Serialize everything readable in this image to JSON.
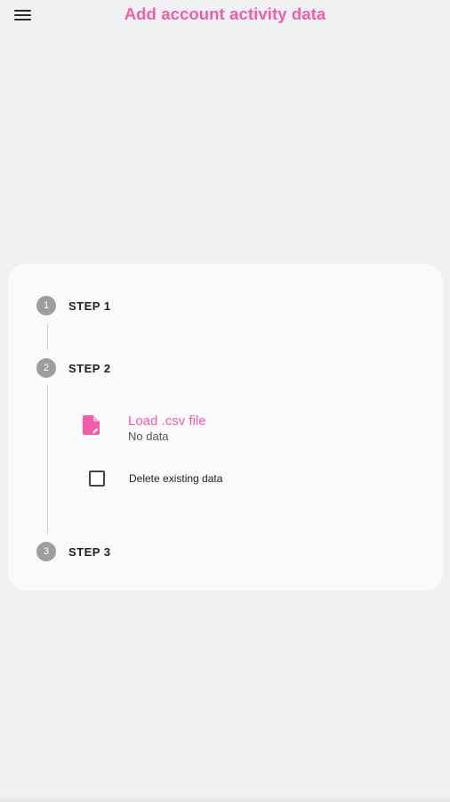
{
  "app_bar": {
    "title": "Add account activity data",
    "menu_icon": "menu-icon"
  },
  "colors": {
    "accent": "#f45cab",
    "background": "#f0f1f3",
    "card": "#fafafa",
    "step_circle": "#9e9e9e"
  },
  "stepper": {
    "steps": [
      {
        "number": "1",
        "label": "STEP 1"
      },
      {
        "number": "2",
        "label": "STEP 2"
      },
      {
        "number": "3",
        "label": "STEP 3"
      }
    ],
    "active_step": 2,
    "step2": {
      "load": {
        "icon": "file-upload-icon",
        "title": "Load .csv file",
        "subtitle": "No data"
      },
      "delete_checkbox": {
        "label": "Delete existing data",
        "checked": false
      }
    }
  }
}
